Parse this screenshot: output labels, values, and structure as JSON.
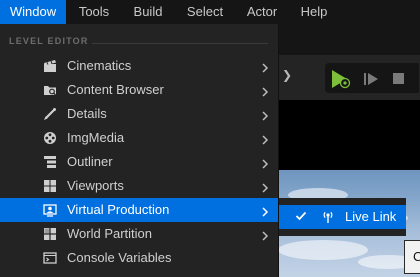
{
  "menubar": {
    "items": [
      "Window",
      "Tools",
      "Build",
      "Select",
      "Actor",
      "Help"
    ],
    "active_index": 0
  },
  "window_menu": {
    "section_header": "LEVEL EDITOR",
    "items": [
      {
        "label": "Cinematics",
        "icon": "clapperboard-icon",
        "has_submenu": true
      },
      {
        "label": "Content Browser",
        "icon": "folder-search-icon",
        "has_submenu": true
      },
      {
        "label": "Details",
        "icon": "edit-brush-icon",
        "has_submenu": true
      },
      {
        "label": "ImgMedia",
        "icon": "film-reel-icon",
        "has_submenu": true
      },
      {
        "label": "Outliner",
        "icon": "outliner-tree-icon",
        "has_submenu": true
      },
      {
        "label": "Viewports",
        "icon": "viewports-grid-icon",
        "has_submenu": true
      },
      {
        "label": "Virtual Production",
        "icon": "virtual-production-icon",
        "has_submenu": true,
        "highlighted": true
      },
      {
        "label": "World Partition",
        "icon": "world-partition-icon",
        "has_submenu": true
      },
      {
        "label": "Console Variables",
        "icon": "console-icon",
        "has_submenu": false
      }
    ]
  },
  "submenu": {
    "items": [
      {
        "label": "Live Link",
        "icon": "live-link-icon",
        "checked": true
      }
    ]
  },
  "background": {
    "tooltip_text": "C"
  },
  "colors": {
    "accent": "#0070e0",
    "menu_bg": "#232323",
    "menubar_bg": "#151515",
    "play_green": "#7dbf3a"
  }
}
